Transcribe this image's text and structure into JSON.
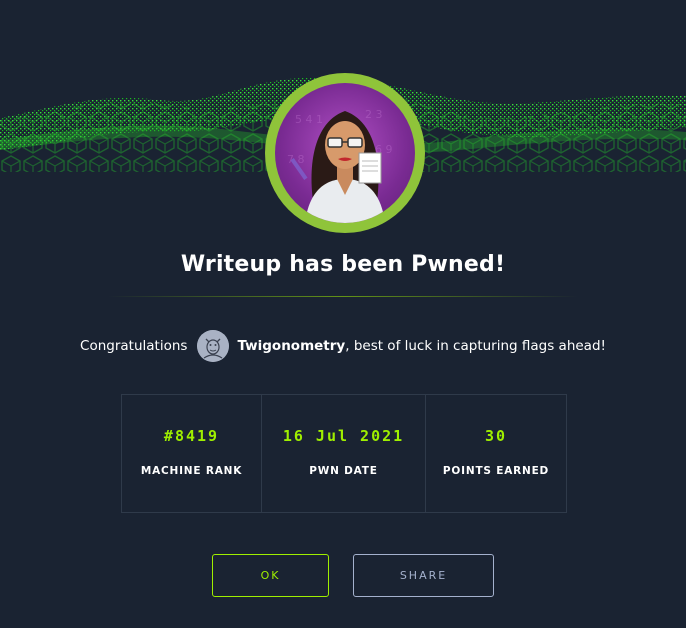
{
  "title": "Writeup has been Pwned!",
  "congrats": {
    "prefix": "Congratulations",
    "username": "Twigonometry",
    "suffix": ", best of luck in capturing flags ahead!"
  },
  "stats": [
    {
      "value": "#8419",
      "label": "MACHINE RANK"
    },
    {
      "value": "16 Jul 2021",
      "label": "PWN DATE"
    },
    {
      "value": "30",
      "label": "POINTS EARNED"
    }
  ],
  "buttons": {
    "ok": "OK",
    "share": "SHARE"
  },
  "colors": {
    "background": "#1a2332",
    "accent": "#9fef00",
    "ring": "#8fc43a",
    "muted": "#a4b1cd"
  }
}
